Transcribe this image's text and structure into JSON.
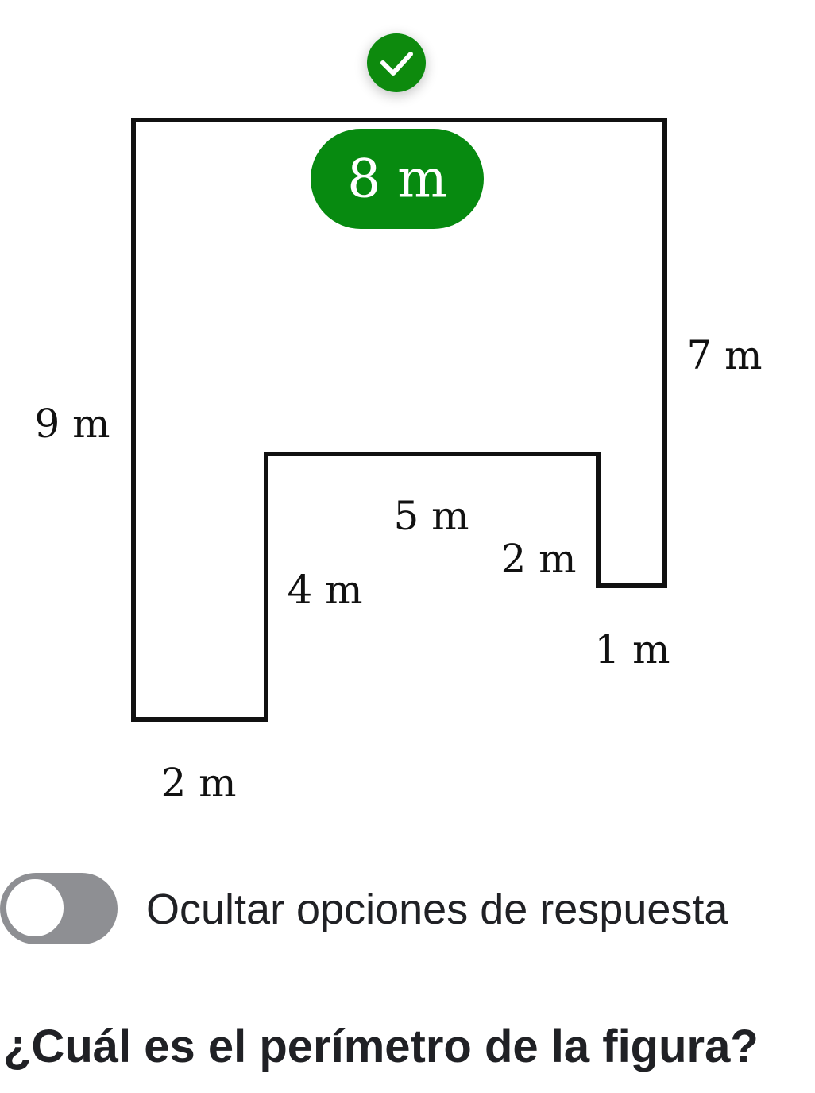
{
  "status": {
    "icon": "check-circle-icon",
    "color": "#078a10"
  },
  "figure": {
    "selected_side": {
      "label": "8 m",
      "color": "#078a10"
    },
    "sides": [
      {
        "id": "left",
        "label": "9 m"
      },
      {
        "id": "right",
        "label": "7 m"
      },
      {
        "id": "inner-top",
        "label": "5 m"
      },
      {
        "id": "inner-right",
        "label": "2 m"
      },
      {
        "id": "inner-left",
        "label": "4 m"
      },
      {
        "id": "bottom-right",
        "label": "1 m"
      },
      {
        "id": "bottom-left",
        "label": "2 m"
      }
    ]
  },
  "toggle": {
    "label": "Ocultar opciones de respuesta",
    "on": false
  },
  "question": {
    "text": "¿Cuál es el perímetro de la figura?"
  }
}
